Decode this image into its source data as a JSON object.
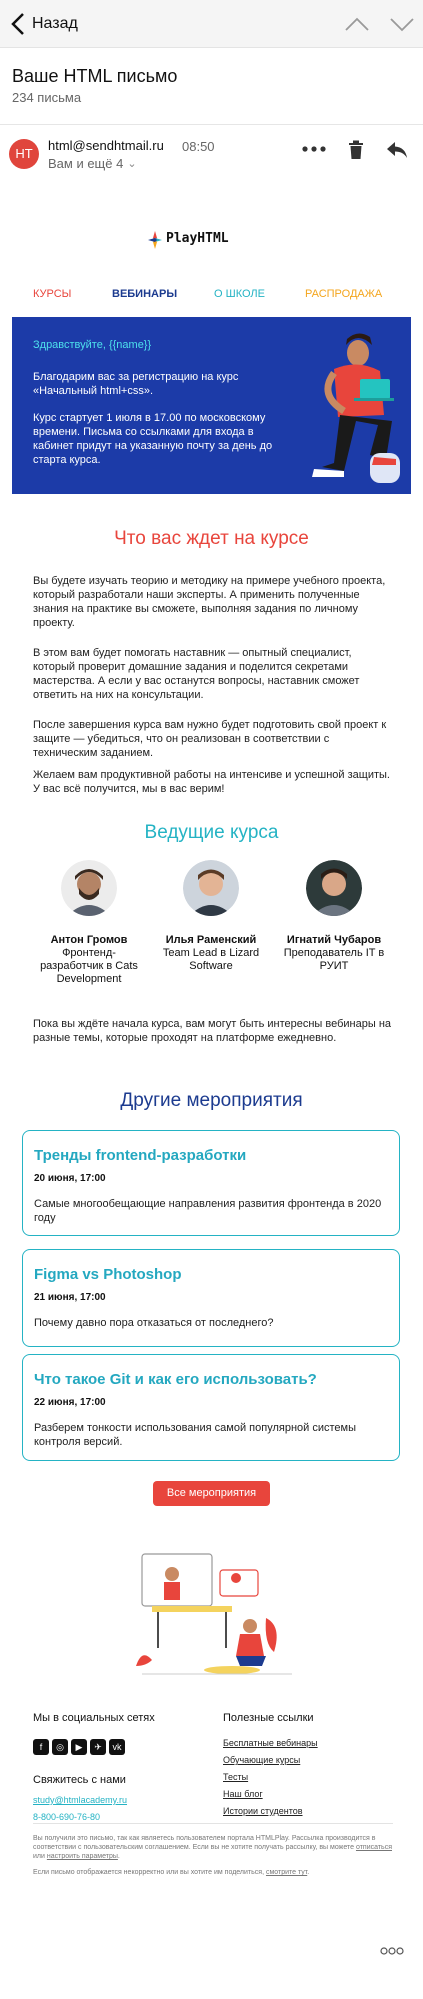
{
  "header": {
    "back_label": "Назад"
  },
  "message": {
    "subject": "Ваше HTML письмо",
    "count": "234 письма",
    "avatar_initials": "HT",
    "sender": "html@sendhtmail.ru",
    "time": "08:50",
    "recipients": "Вам и ещё 4"
  },
  "email": {
    "logo_text": "PlayHTML",
    "nav": [
      "КУРСЫ",
      "ВЕБИНАРЫ",
      "О ШКОЛЕ",
      "РАСПРОДАЖА"
    ],
    "hero": {
      "greeting": "Здравствуйте, {{name}}",
      "thanks": "Благодарим вас за регистрацию на курс «Начальный html+css».",
      "course_start": "Курс стартует 1 июля в 17.00 по московскому времени. Письма со ссылками для входа в кабинет придут на указанную почту за день до старта курса."
    },
    "what_title": "Что вас ждет на курсе",
    "paragraphs": [
      "Вы будете изучать теорию и методику на примере учебного проекта, который разработали наши эксперты. А применить полученные знания на практике вы сможете, выполняя задания по личному проекту.",
      "В этом вам будет помогать наставник — опытный специалист, который проверит домашние задания и поделится секретами мастерства. А если у вас останутся вопросы, наставник сможет ответить на них на консультации.",
      "После завершения курса вам нужно будет подготовить свой проект к защите — убедиться, что он реализован в соответствии с техническим заданием.",
      "Желаем вам продуктивной работы на интенсиве и успешной защиты. У вас всё получится, мы в вас верим!"
    ],
    "teachers_title": "Ведущие курса",
    "teachers": [
      {
        "name": "Антон Громов",
        "role": "Фронтенд-разработчик в Cats Development"
      },
      {
        "name": "Илья Раменский",
        "role": "Team Lead в Lizard Software"
      },
      {
        "name": "Игнатий Чубаров",
        "role": "Преподаватель IT в РУИТ"
      }
    ],
    "webinars_note": "Пока вы ждёте начала курса, вам могут быть интересны вебинары на разные темы, которые проходят на платформе ежедневно.",
    "events_title": "Другие мероприятия",
    "events": [
      {
        "title": "Тренды frontend-разработки",
        "date": "20 июня, 17:00",
        "desc": "Самые многообещающие направления развития фронтенда в 2020 году"
      },
      {
        "title": "Figma vs Photoshop",
        "date": "21 июня, 17:00",
        "desc": "Почему давно пора отказаться от последнего?"
      },
      {
        "title": "Что такое Git и как его использовать?",
        "date": "22 июня, 17:00",
        "desc": "Разберем тонкости использования самой популярной системы контроля версий."
      }
    ],
    "all_events_button": "Все мероприятия",
    "footer": {
      "social_title": "Мы в социальных сетях",
      "social_icons": [
        "facebook-icon",
        "instagram-icon",
        "youtube-icon",
        "telegram-icon",
        "vk-icon"
      ],
      "social_glyphs": [
        "f",
        "◎",
        "▶",
        "✈",
        "vk"
      ],
      "links_title": "Полезные ссылки",
      "links": [
        "Бесплатные вебинары",
        "Обучающие курсы",
        "Тесты",
        "Наш блог",
        "Истории студентов"
      ],
      "contact_title": "Свяжитесь с нами",
      "email": "study@htmlacademy.ru",
      "phone": "8-800-690-76-80",
      "legal_1a": "Вы получили это письмо, так как являетесь пользователем портала HTMLPlay. Рассылка производится в соответствии с пользовательским соглашением. Если вы не хотите получать рассылку, вы можете ",
      "legal_1_link1": "отписаться",
      "legal_1b": " или ",
      "legal_1_link2": "настроить параметры",
      "legal_1c": ".",
      "legal_2a": "Если письмо отображается некорректно или вы хотите им поделиться, ",
      "legal_2_link": "смотрите тут",
      "legal_2b": "."
    }
  },
  "colors": {
    "accent_red": "#e8453c",
    "teal": "#24b3c4",
    "navy": "#1c3b8f",
    "hero_blue": "#1c3ba8",
    "orange": "#f4a51c"
  }
}
